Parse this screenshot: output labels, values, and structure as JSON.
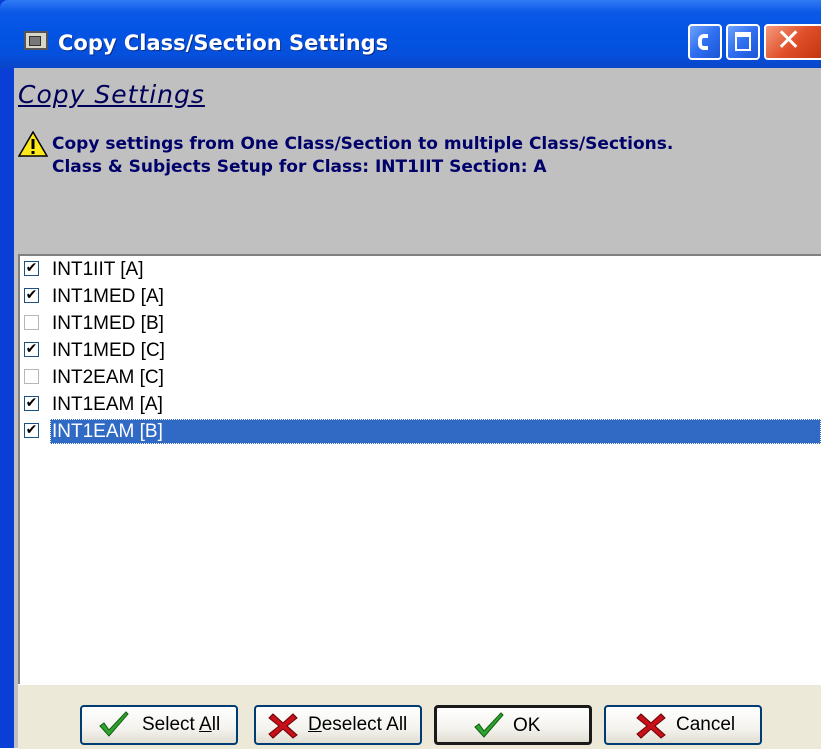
{
  "window": {
    "title": "Copy Class/Section Settings",
    "controls": {
      "minimize": "minimize",
      "maximize": "maximize",
      "close": "✕"
    }
  },
  "header": {
    "heading": "Copy Settings",
    "message_line1": "Copy settings from One Class/Section to multiple Class/Sections.",
    "message_line2": "Class & Subjects Setup for Class: INT1IIT Section: A"
  },
  "list": {
    "items": [
      {
        "label": "INT1IIT [A]",
        "checked": "✔"
      },
      {
        "label": "INT1MED [A]",
        "checked": "✔"
      },
      {
        "label": "INT1MED [B]",
        "checked": ""
      },
      {
        "label": "INT1MED [C]",
        "checked": "✔"
      },
      {
        "label": "INT2EAM [C]",
        "checked": ""
      },
      {
        "label": "INT1EAM [A]",
        "checked": "✔"
      },
      {
        "label": "INT1EAM [B]",
        "checked": "✔"
      }
    ],
    "selected_index": 6
  },
  "buttons": {
    "select_all": {
      "pre": "Select ",
      "accel": "A",
      "post": "ll"
    },
    "deselect_all": {
      "pre": "",
      "accel": "D",
      "post": "eselect All"
    },
    "ok": {
      "label": "OK"
    },
    "cancel": {
      "label": "Cancel"
    }
  },
  "colors": {
    "title_bar": "#0353e4",
    "client_bg": "#c0c0c0",
    "heading": "#00005a",
    "selection": "#316ac5",
    "check_green": "#2fa22f",
    "cross_red": "#c8101a"
  }
}
